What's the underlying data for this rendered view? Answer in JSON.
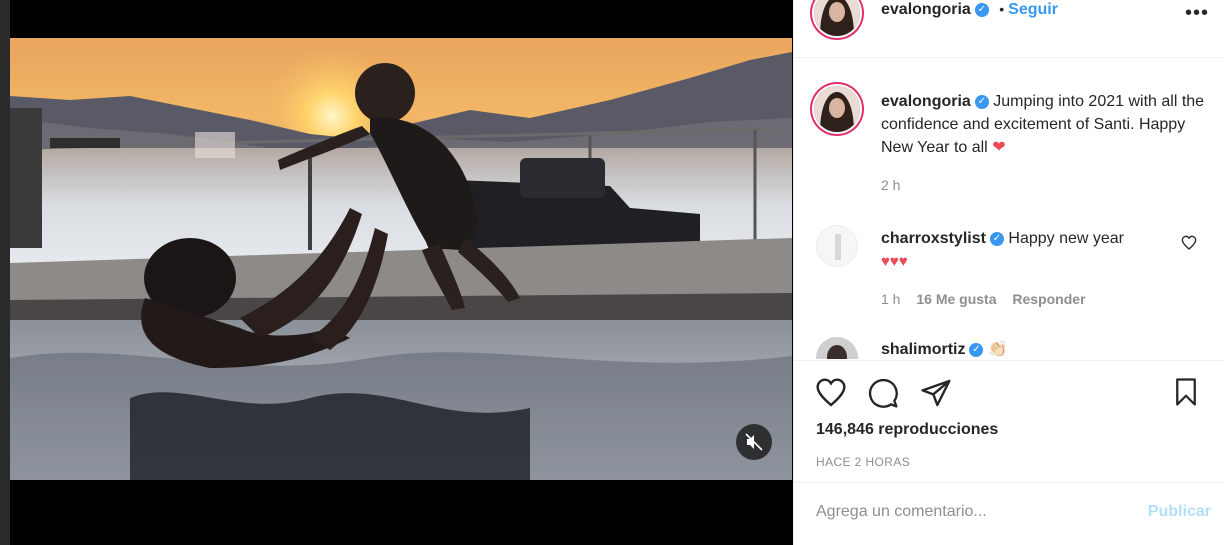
{
  "post": {
    "username": "evalongoria",
    "follow_label": "Seguir",
    "separator": "•",
    "more_icon": "more-dots-icon"
  },
  "caption": {
    "username": "evalongoria",
    "text": "Jumping into 2021 with all the confidence and excitement of Santi. Happy New Year to all",
    "emoji": "❤",
    "time": "2 h"
  },
  "comments": [
    {
      "username": "charroxstylist",
      "text": "Happy new year",
      "hearts": "♥♥♥",
      "time": "1 h",
      "likes": "16 Me gusta",
      "reply_label": "Responder"
    },
    {
      "username": "shalimortiz",
      "text": "👏🏻"
    }
  ],
  "actions": {
    "like_icon": "heart-icon",
    "comment_icon": "comment-bubble-icon",
    "share_icon": "paper-plane-icon",
    "save_icon": "bookmark-icon"
  },
  "stats": {
    "views": "146,846 reproducciones",
    "time_ago": "HACE 2 HORAS"
  },
  "comment_box": {
    "placeholder": "Agrega un comentario...",
    "publish_label": "Publicar"
  },
  "colors": {
    "accent": "#3897f0",
    "heart_red": "#ed4956",
    "publish_disabled": "#b2dffc",
    "muted_text": "#8e8e8e"
  }
}
